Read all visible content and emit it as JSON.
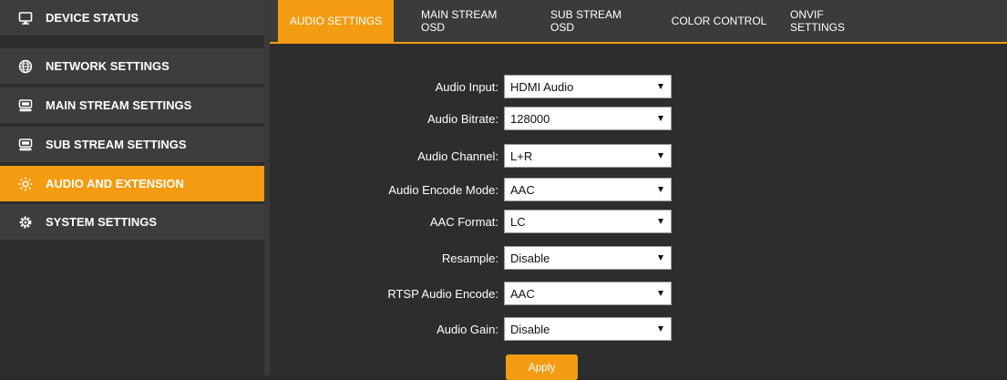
{
  "sidebar": {
    "items": [
      {
        "label": "DEVICE STATUS",
        "icon": "monitor-icon",
        "active": false
      },
      {
        "label": "NETWORK SETTINGS",
        "icon": "globe-icon",
        "active": false
      },
      {
        "label": "MAIN STREAM SETTINGS",
        "icon": "video-device-icon",
        "active": false
      },
      {
        "label": "SUB STREAM SETTINGS",
        "icon": "video-device-icon",
        "active": false
      },
      {
        "label": "AUDIO AND EXTENSION",
        "icon": "sun-dots-icon",
        "active": true
      },
      {
        "label": "SYSTEM SETTINGS",
        "icon": "gear-icon",
        "active": false
      }
    ]
  },
  "tabs": [
    {
      "label": "AUDIO SETTINGS",
      "active": true
    },
    {
      "label": "MAIN STREAM OSD",
      "active": false
    },
    {
      "label": "SUB STREAM OSD",
      "active": false
    },
    {
      "label": "COLOR CONTROL",
      "active": false
    },
    {
      "label": "ONVIF SETTINGS",
      "active": false
    }
  ],
  "form": {
    "fields": [
      {
        "label": "Audio Input:",
        "value": "HDMI Audio"
      },
      {
        "label": "Audio Bitrate:",
        "value": "128000"
      },
      {
        "label": "Audio Channel:",
        "value": "L+R"
      },
      {
        "label": "Audio Encode Mode:",
        "value": "AAC"
      },
      {
        "label": "AAC Format:",
        "value": "LC"
      },
      {
        "label": "Resample:",
        "value": "Disable"
      },
      {
        "label": "RTSP Audio Encode:",
        "value": "AAC"
      },
      {
        "label": "Audio Gain:",
        "value": "Disable"
      }
    ],
    "apply_label": "Apply"
  },
  "colors": {
    "accent": "#f39c12",
    "sidebar_item_bg": "#3d3d3d",
    "background": "#2d2d2d"
  }
}
